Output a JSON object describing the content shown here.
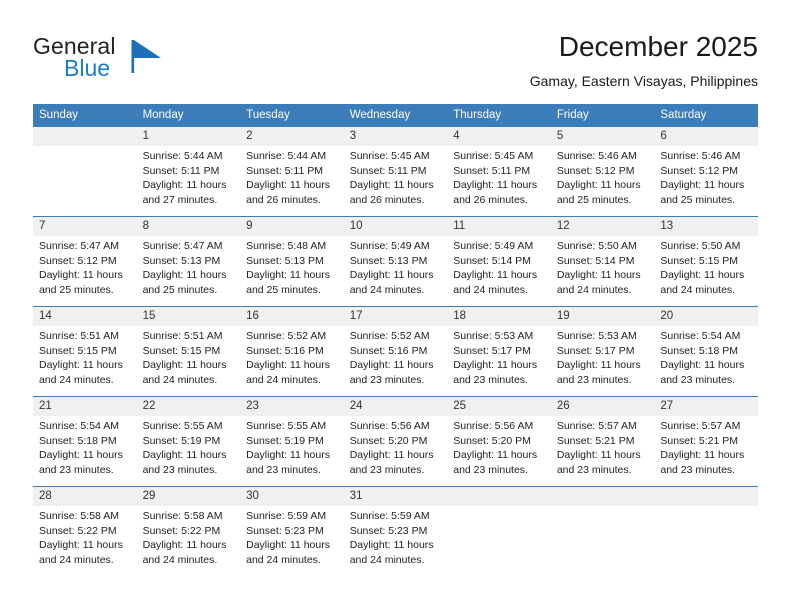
{
  "brand": {
    "name_top": "General",
    "name_bottom": "Blue",
    "mark_icon": "blue-triangle-flag-icon",
    "color_dark": "#231f20",
    "color_blue": "#1d7cc4"
  },
  "header": {
    "title": "December 2025",
    "subtitle": "Gamay, Eastern Visayas, Philippines"
  },
  "theme": {
    "header_blue": "#3b7cb9",
    "daynum_band": "#f0f0f0",
    "text": "#222222"
  },
  "calendar": {
    "weekdays": [
      "Sunday",
      "Monday",
      "Tuesday",
      "Wednesday",
      "Thursday",
      "Friday",
      "Saturday"
    ],
    "weeks": [
      [
        {
          "day": "",
          "sunrise": "",
          "sunset": "",
          "daylight": "",
          "empty": true
        },
        {
          "day": "1",
          "sunrise": "Sunrise: 5:44 AM",
          "sunset": "Sunset: 5:11 PM",
          "daylight": "Daylight: 11 hours and 27 minutes."
        },
        {
          "day": "2",
          "sunrise": "Sunrise: 5:44 AM",
          "sunset": "Sunset: 5:11 PM",
          "daylight": "Daylight: 11 hours and 26 minutes."
        },
        {
          "day": "3",
          "sunrise": "Sunrise: 5:45 AM",
          "sunset": "Sunset: 5:11 PM",
          "daylight": "Daylight: 11 hours and 26 minutes."
        },
        {
          "day": "4",
          "sunrise": "Sunrise: 5:45 AM",
          "sunset": "Sunset: 5:11 PM",
          "daylight": "Daylight: 11 hours and 26 minutes."
        },
        {
          "day": "5",
          "sunrise": "Sunrise: 5:46 AM",
          "sunset": "Sunset: 5:12 PM",
          "daylight": "Daylight: 11 hours and 25 minutes."
        },
        {
          "day": "6",
          "sunrise": "Sunrise: 5:46 AM",
          "sunset": "Sunset: 5:12 PM",
          "daylight": "Daylight: 11 hours and 25 minutes."
        }
      ],
      [
        {
          "day": "7",
          "sunrise": "Sunrise: 5:47 AM",
          "sunset": "Sunset: 5:12 PM",
          "daylight": "Daylight: 11 hours and 25 minutes."
        },
        {
          "day": "8",
          "sunrise": "Sunrise: 5:47 AM",
          "sunset": "Sunset: 5:13 PM",
          "daylight": "Daylight: 11 hours and 25 minutes."
        },
        {
          "day": "9",
          "sunrise": "Sunrise: 5:48 AM",
          "sunset": "Sunset: 5:13 PM",
          "daylight": "Daylight: 11 hours and 25 minutes."
        },
        {
          "day": "10",
          "sunrise": "Sunrise: 5:49 AM",
          "sunset": "Sunset: 5:13 PM",
          "daylight": "Daylight: 11 hours and 24 minutes."
        },
        {
          "day": "11",
          "sunrise": "Sunrise: 5:49 AM",
          "sunset": "Sunset: 5:14 PM",
          "daylight": "Daylight: 11 hours and 24 minutes."
        },
        {
          "day": "12",
          "sunrise": "Sunrise: 5:50 AM",
          "sunset": "Sunset: 5:14 PM",
          "daylight": "Daylight: 11 hours and 24 minutes."
        },
        {
          "day": "13",
          "sunrise": "Sunrise: 5:50 AM",
          "sunset": "Sunset: 5:15 PM",
          "daylight": "Daylight: 11 hours and 24 minutes."
        }
      ],
      [
        {
          "day": "14",
          "sunrise": "Sunrise: 5:51 AM",
          "sunset": "Sunset: 5:15 PM",
          "daylight": "Daylight: 11 hours and 24 minutes."
        },
        {
          "day": "15",
          "sunrise": "Sunrise: 5:51 AM",
          "sunset": "Sunset: 5:15 PM",
          "daylight": "Daylight: 11 hours and 24 minutes."
        },
        {
          "day": "16",
          "sunrise": "Sunrise: 5:52 AM",
          "sunset": "Sunset: 5:16 PM",
          "daylight": "Daylight: 11 hours and 24 minutes."
        },
        {
          "day": "17",
          "sunrise": "Sunrise: 5:52 AM",
          "sunset": "Sunset: 5:16 PM",
          "daylight": "Daylight: 11 hours and 23 minutes."
        },
        {
          "day": "18",
          "sunrise": "Sunrise: 5:53 AM",
          "sunset": "Sunset: 5:17 PM",
          "daylight": "Daylight: 11 hours and 23 minutes."
        },
        {
          "day": "19",
          "sunrise": "Sunrise: 5:53 AM",
          "sunset": "Sunset: 5:17 PM",
          "daylight": "Daylight: 11 hours and 23 minutes."
        },
        {
          "day": "20",
          "sunrise": "Sunrise: 5:54 AM",
          "sunset": "Sunset: 5:18 PM",
          "daylight": "Daylight: 11 hours and 23 minutes."
        }
      ],
      [
        {
          "day": "21",
          "sunrise": "Sunrise: 5:54 AM",
          "sunset": "Sunset: 5:18 PM",
          "daylight": "Daylight: 11 hours and 23 minutes."
        },
        {
          "day": "22",
          "sunrise": "Sunrise: 5:55 AM",
          "sunset": "Sunset: 5:19 PM",
          "daylight": "Daylight: 11 hours and 23 minutes."
        },
        {
          "day": "23",
          "sunrise": "Sunrise: 5:55 AM",
          "sunset": "Sunset: 5:19 PM",
          "daylight": "Daylight: 11 hours and 23 minutes."
        },
        {
          "day": "24",
          "sunrise": "Sunrise: 5:56 AM",
          "sunset": "Sunset: 5:20 PM",
          "daylight": "Daylight: 11 hours and 23 minutes."
        },
        {
          "day": "25",
          "sunrise": "Sunrise: 5:56 AM",
          "sunset": "Sunset: 5:20 PM",
          "daylight": "Daylight: 11 hours and 23 minutes."
        },
        {
          "day": "26",
          "sunrise": "Sunrise: 5:57 AM",
          "sunset": "Sunset: 5:21 PM",
          "daylight": "Daylight: 11 hours and 23 minutes."
        },
        {
          "day": "27",
          "sunrise": "Sunrise: 5:57 AM",
          "sunset": "Sunset: 5:21 PM",
          "daylight": "Daylight: 11 hours and 23 minutes."
        }
      ],
      [
        {
          "day": "28",
          "sunrise": "Sunrise: 5:58 AM",
          "sunset": "Sunset: 5:22 PM",
          "daylight": "Daylight: 11 hours and 24 minutes."
        },
        {
          "day": "29",
          "sunrise": "Sunrise: 5:58 AM",
          "sunset": "Sunset: 5:22 PM",
          "daylight": "Daylight: 11 hours and 24 minutes."
        },
        {
          "day": "30",
          "sunrise": "Sunrise: 5:59 AM",
          "sunset": "Sunset: 5:23 PM",
          "daylight": "Daylight: 11 hours and 24 minutes."
        },
        {
          "day": "31",
          "sunrise": "Sunrise: 5:59 AM",
          "sunset": "Sunset: 5:23 PM",
          "daylight": "Daylight: 11 hours and 24 minutes."
        },
        {
          "day": "",
          "sunrise": "",
          "sunset": "",
          "daylight": "",
          "empty": true
        },
        {
          "day": "",
          "sunrise": "",
          "sunset": "",
          "daylight": "",
          "empty": true
        },
        {
          "day": "",
          "sunrise": "",
          "sunset": "",
          "daylight": "",
          "empty": true
        }
      ]
    ]
  }
}
